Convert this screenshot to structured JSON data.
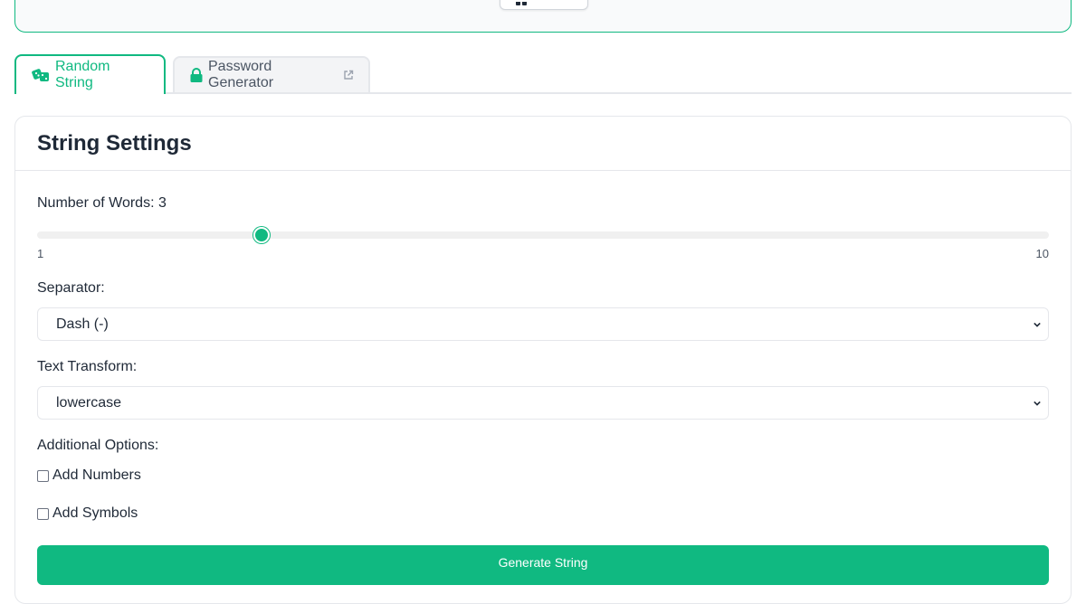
{
  "tabs": [
    {
      "label": "Random String",
      "icon": "dice-icon",
      "active": true
    },
    {
      "label": "Password Generator",
      "icon": "lock-icon",
      "external_icon": "external-link-icon",
      "active": false
    }
  ],
  "settings": {
    "title": "String Settings",
    "words_label": "Number of Words:",
    "words_value": "3",
    "slider": {
      "min": "1",
      "max": "10",
      "value": 3
    },
    "separator_label": "Separator:",
    "separator_value": "Dash (-)",
    "transform_label": "Text Transform:",
    "transform_value": "lowercase",
    "options_label": "Additional Options:",
    "add_numbers_label": "Add Numbers",
    "add_symbols_label": "Add Symbols",
    "generate_label": "Generate String"
  },
  "colors": {
    "accent": "#10b981",
    "border": "#e5e7eb",
    "text": "#1f2937"
  }
}
